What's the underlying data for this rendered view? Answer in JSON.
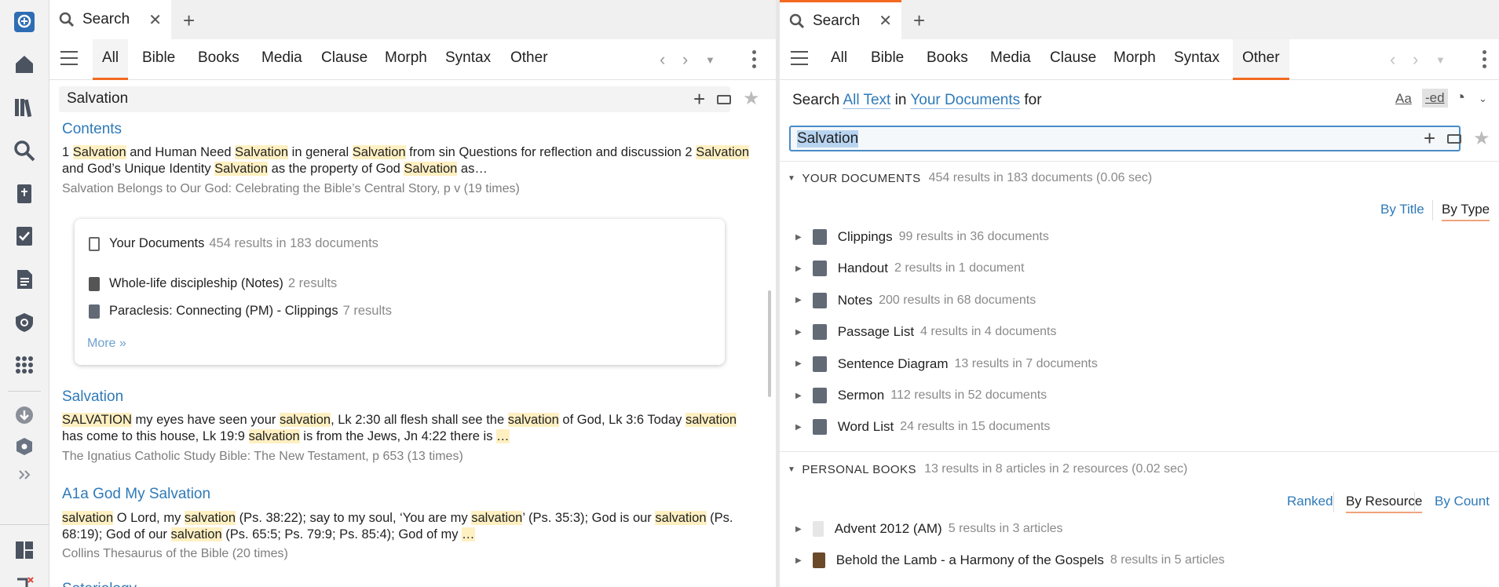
{
  "rail": {
    "icons": [
      "logos-home-logo-icon",
      "home-icon",
      "library-icon",
      "search-icon",
      "bible-icon",
      "checklist-icon",
      "document-icon",
      "shield-icon",
      "apps-grid-icon",
      "download-icon",
      "gear-shield-icon",
      "expand-icon",
      "layout-icon",
      "extra-icon"
    ]
  },
  "left": {
    "tab_label": "Search",
    "nav": [
      "All",
      "Bible",
      "Books",
      "Media",
      "Clause",
      "Morph",
      "Syntax",
      "Other"
    ],
    "nav_active": "All",
    "search_value": "Salvation",
    "results": [
      {
        "title": "Contents",
        "segments": [
          {
            "t": "1 "
          },
          {
            "t": "Salvation",
            "h": true
          },
          {
            "t": " and Human Need "
          },
          {
            "t": "Salvation",
            "h": true
          },
          {
            "t": " in general "
          },
          {
            "t": "Salvation",
            "h": true
          },
          {
            "t": " from sin Questions for reflection and discussion 2 "
          },
          {
            "t": "Salvation",
            "h": true
          },
          {
            "t": " and God’s Unique Identity "
          },
          {
            "t": "Salvation",
            "h": true
          },
          {
            "t": " as the property of God "
          },
          {
            "t": "Salvation",
            "h": true
          },
          {
            "t": " as…"
          }
        ],
        "source": "Salvation Belongs to Our God: Celebrating the Bible’s Central Story, p v (19 times)"
      },
      {
        "title": "Salvation",
        "segments": [
          {
            "t": "SALVATION",
            "h": true
          },
          {
            "t": " my eyes have seen your "
          },
          {
            "t": "salvation",
            "h": true
          },
          {
            "t": ", Lk 2:30 all flesh shall see the "
          },
          {
            "t": "salvation",
            "h": true
          },
          {
            "t": " of God, Lk 3:6 Today "
          },
          {
            "t": "salvation",
            "h": true
          },
          {
            "t": " has come to this house, Lk 19:9 "
          },
          {
            "t": "salvation",
            "h": true
          },
          {
            "t": " is from the Jews, Jn 4:22 there is "
          },
          {
            "t": "…",
            "h": true
          }
        ],
        "source": "The Ignatius Catholic Study Bible: The New Testament, p 653 (13 times)"
      },
      {
        "title": "A1a God My Salvation",
        "segments": [
          {
            "t": "salvation",
            "h": true
          },
          {
            "t": " O Lord, my "
          },
          {
            "t": "salvation",
            "h": true
          },
          {
            "t": " (Ps. 38:22); say to my soul, ‘You are my "
          },
          {
            "t": "salvation",
            "h": true
          },
          {
            "t": "’ (Ps. 35:3); God is our "
          },
          {
            "t": "salvation",
            "h": true
          },
          {
            "t": " (Ps. 68:19); God of our "
          },
          {
            "t": "salvation",
            "h": true
          },
          {
            "t": " (Ps. 65:5; Ps. 79:9; Ps. 85:4); God of my "
          },
          {
            "t": "…",
            "h": true
          }
        ],
        "source": "Collins Thesaurus of the Bible (20 times)"
      }
    ],
    "card": {
      "header_label": "Your Documents",
      "header_meta": "454 results in 183 documents",
      "items": [
        {
          "label": "Whole-life discipleship (Notes)",
          "meta": "2 results"
        },
        {
          "label": "Paraclesis: Connecting (PM) - Clippings",
          "meta": "7 results"
        }
      ],
      "more": "More »"
    },
    "cut_off_title": "Soteriology"
  },
  "right": {
    "tab_label": "Search",
    "nav": [
      "All",
      "Bible",
      "Books",
      "Media",
      "Clause",
      "Morph",
      "Syntax",
      "Other"
    ],
    "nav_active": "Other",
    "line": {
      "pre": "Search ",
      "scope": "All Text",
      "mid": " in ",
      "source": "Your Documents",
      "post": " for"
    },
    "tools": {
      "case": "Aa",
      "ed": "-ed"
    },
    "search_value": "Salvation",
    "your_documents": {
      "title": "YOUR DOCUMENTS",
      "meta": "454 results in 183 documents (0.06 sec)",
      "sort": [
        "By Title",
        "By Type"
      ],
      "sort_selected": "By Type",
      "types": [
        {
          "label": "Clippings",
          "meta": "99 results in 36 documents",
          "icon": "clippings-icon"
        },
        {
          "label": "Handout",
          "meta": "2 results in 1 document",
          "icon": "handout-icon"
        },
        {
          "label": "Notes",
          "meta": "200 results in 68 documents",
          "icon": "notes-icon"
        },
        {
          "label": "Passage List",
          "meta": "4 results in 4 documents",
          "icon": "passage-list-icon"
        },
        {
          "label": "Sentence Diagram",
          "meta": "13 results in 7 documents",
          "icon": "sentence-diagram-icon"
        },
        {
          "label": "Sermon",
          "meta": "112 results in 52 documents",
          "icon": "sermon-icon"
        },
        {
          "label": "Word List",
          "meta": "24 results in 15 documents",
          "icon": "word-list-icon"
        }
      ]
    },
    "personal_books": {
      "title": "PERSONAL BOOKS",
      "meta": "13 results in 8 articles in 2 resources (0.02 sec)",
      "sort": [
        "Ranked",
        "By Resource",
        "By Count"
      ],
      "sort_selected": "By Resource",
      "items": [
        {
          "label": "Advent 2012 (AM)",
          "meta": "5 results in 3 articles"
        },
        {
          "label": "Behold the Lamb - a Harmony of the Gospels",
          "meta": "8 results in 5 articles"
        }
      ]
    }
  },
  "colors": {
    "accent": "#f26a21",
    "link": "#2f7ab8",
    "highlight": "#fff0c2"
  }
}
